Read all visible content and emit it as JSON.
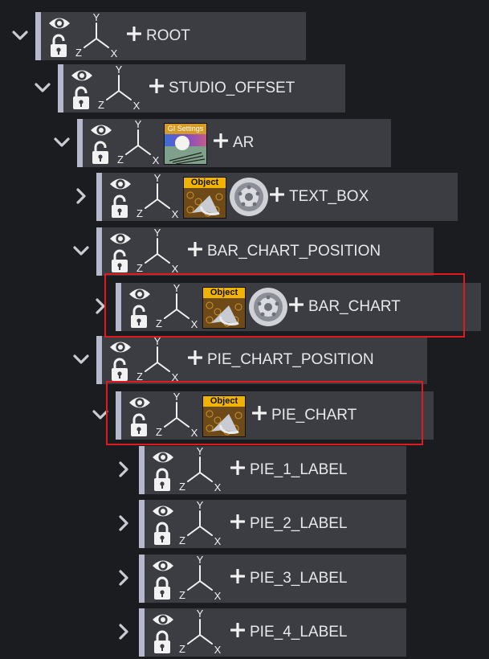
{
  "scene_tree": {
    "nodes": [
      {
        "name": "ROOT",
        "expanded": true,
        "icons": []
      },
      {
        "name": "STUDIO_OFFSET",
        "expanded": true,
        "icons": []
      },
      {
        "name": "AR",
        "expanded": true,
        "icons": [
          "gi-settings-texture"
        ],
        "gi_label": "GI Settings"
      },
      {
        "name": "TEXT_BOX",
        "expanded": false,
        "icons": [
          "object-texture",
          "geometry-wheel"
        ],
        "object_label": "Object"
      },
      {
        "name": "BAR_CHART_POSITION",
        "expanded": true,
        "icons": []
      },
      {
        "name": "BAR_CHART",
        "expanded": false,
        "icons": [
          "object-texture",
          "geometry-wheel"
        ],
        "object_label": "Object",
        "highlighted": true
      },
      {
        "name": "PIE_CHART_POSITION",
        "expanded": true,
        "icons": []
      },
      {
        "name": "PIE_CHART",
        "expanded": true,
        "icons": [
          "object-texture"
        ],
        "object_label": "Object",
        "highlighted": true
      },
      {
        "name": "PIE_1_LABEL",
        "expanded": false,
        "icons": []
      },
      {
        "name": "PIE_2_LABEL",
        "expanded": false,
        "icons": []
      },
      {
        "name": "PIE_3_LABEL",
        "expanded": false,
        "icons": []
      },
      {
        "name": "PIE_4_LABEL",
        "expanded": false,
        "icons": []
      }
    ],
    "axis_labels": {
      "x": "X",
      "y": "Y",
      "z": "Z"
    },
    "highlight_color": "#e01b1f",
    "row_bg": "#3b3d43",
    "side_bar_color": "#b6b9cb"
  }
}
